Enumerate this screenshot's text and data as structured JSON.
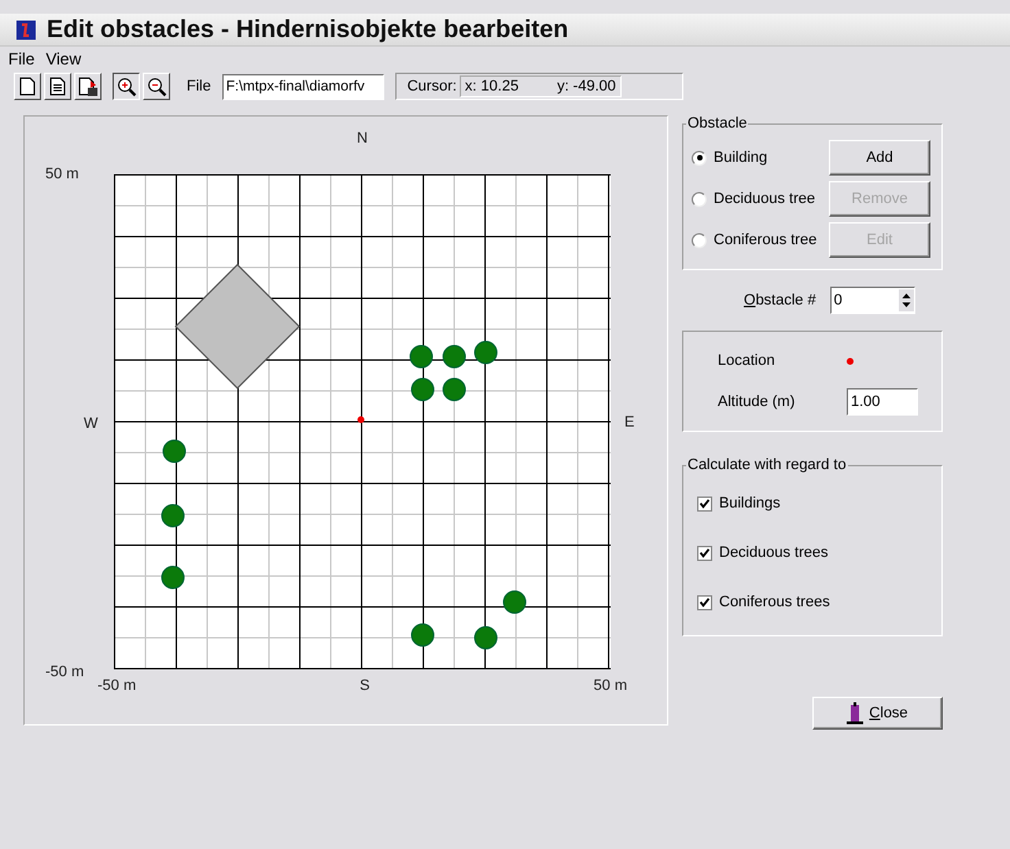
{
  "window": {
    "title": "Edit obstacles - Hindernisobjekte bearbeiten"
  },
  "menu": [
    "File",
    "View"
  ],
  "toolbar": {
    "tools": [
      {
        "kind": "new",
        "pressed": false
      },
      {
        "kind": "open",
        "pressed": false
      },
      {
        "kind": "save",
        "pressed": false
      },
      {
        "kind": "zoom_in",
        "pressed": true
      },
      {
        "kind": "zoom_out",
        "pressed": false
      }
    ],
    "file_label": "File",
    "file_path": "F:\\mtpx-final\\diamorfv",
    "cursor_label": "Cursor:",
    "cursor_x": "x: 10.25",
    "cursor_y": "y: -49.00"
  },
  "plot": {
    "north": "N",
    "south": "S",
    "west": "W",
    "east": "E",
    "y_max": "50 m",
    "y_min": "-50 m",
    "x_min": "-50 m",
    "x_max": "50 m"
  },
  "obstacle": {
    "title": "Obstacle",
    "types": [
      {
        "label": "Building",
        "selected": true
      },
      {
        "label": "Deciduous tree",
        "selected": false
      },
      {
        "label": "Coniferous tree",
        "selected": false
      }
    ],
    "buttons": [
      {
        "label": "Add",
        "disabled": false
      },
      {
        "label": "Remove",
        "disabled": true
      },
      {
        "label": "Edit",
        "disabled": true
      }
    ]
  },
  "obstacle_number": {
    "label": "Obstacle #",
    "value": "0"
  },
  "location": {
    "label": "Location",
    "altitude_label": "Altitude (m)",
    "altitude": "1.00"
  },
  "calculate": {
    "title": "Calculate with regard to",
    "options": [
      {
        "label": "Buildings",
        "checked": true
      },
      {
        "label": "Deciduous trees",
        "checked": true
      },
      {
        "label": "Coniferous trees",
        "checked": true
      }
    ]
  },
  "close_button": "Close"
}
